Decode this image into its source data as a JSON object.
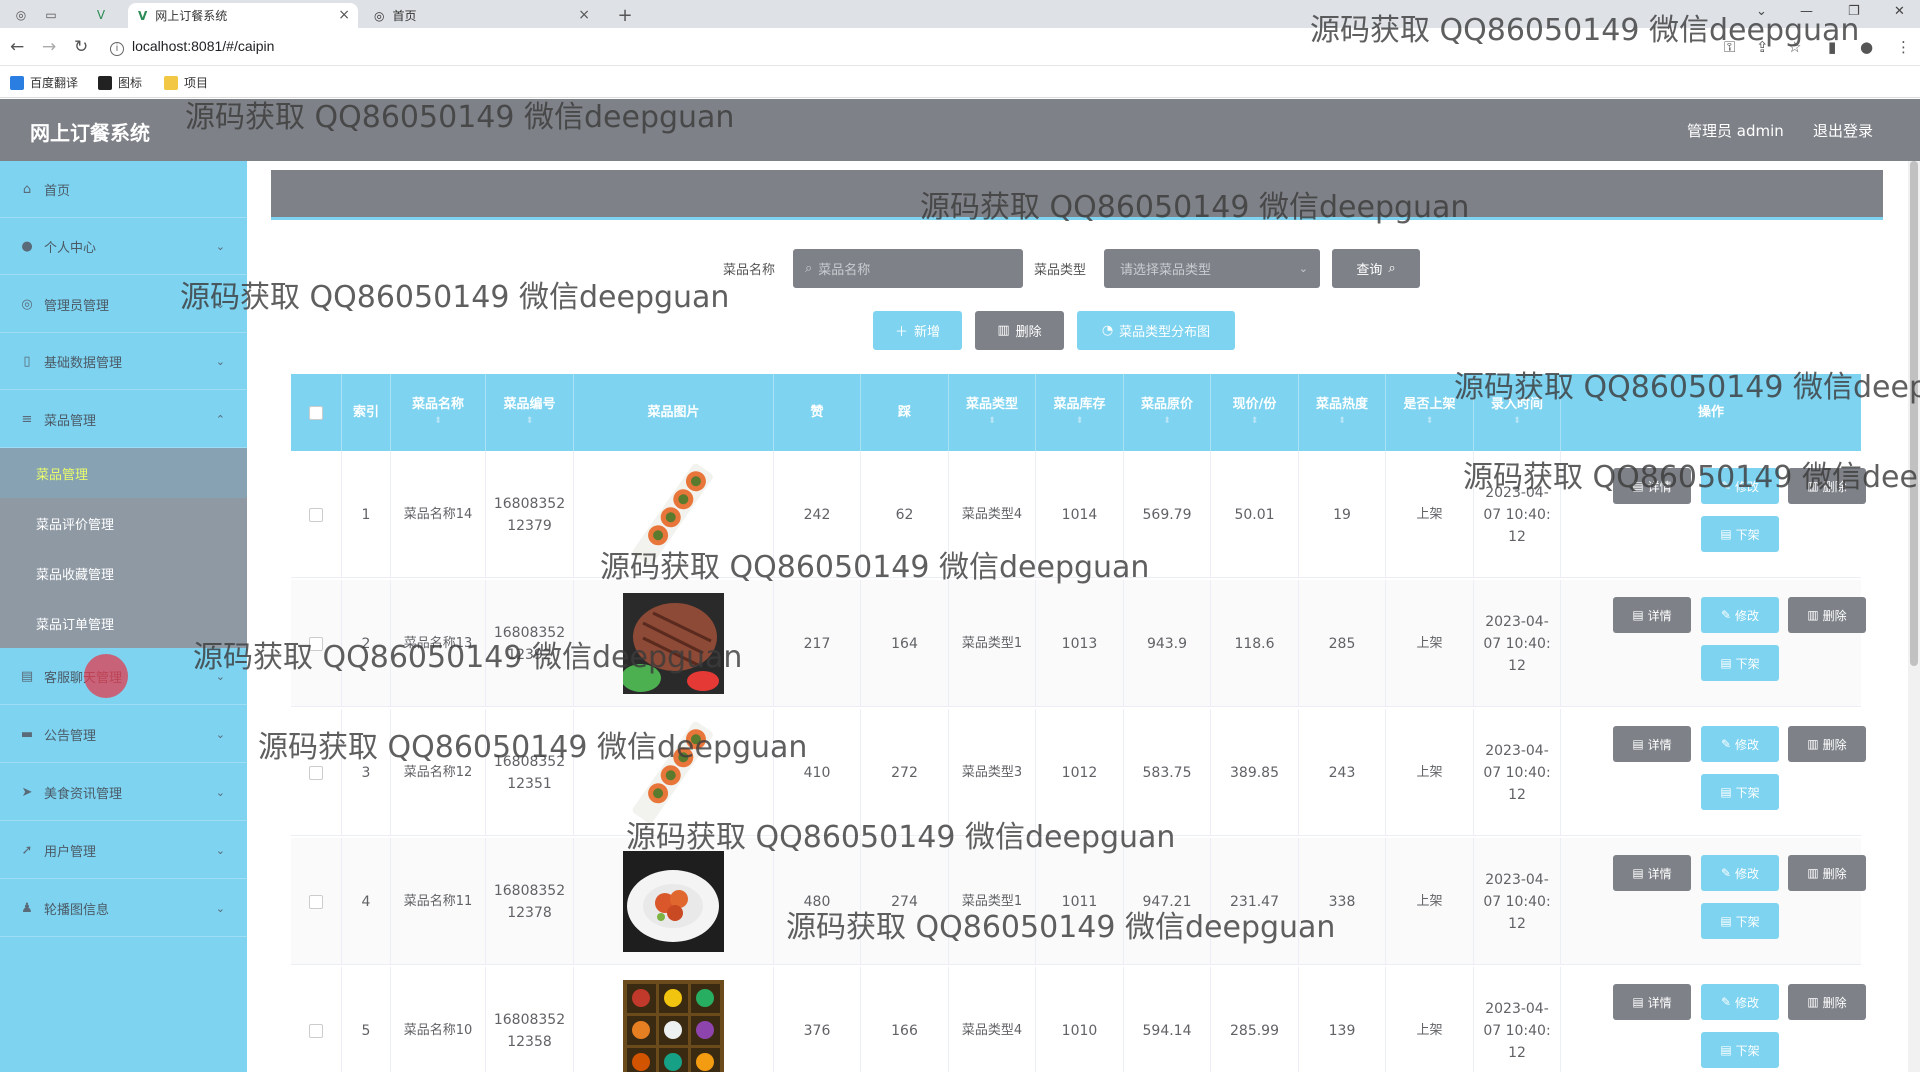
{
  "browser": {
    "tabs": [
      {
        "label": "网上订餐系统",
        "close": "×"
      },
      {
        "label": "首页",
        "close": "×"
      }
    ],
    "new_tab": "+",
    "url": "localhost:8081/#/caipin",
    "bookmarks": [
      "百度翻译",
      "图标",
      "项目"
    ]
  },
  "header": {
    "title": "网上订餐系统",
    "user": "管理员 admin",
    "logout": "退出登录"
  },
  "sidebar": {
    "items": [
      {
        "label": "首页",
        "icon": "home-icon"
      },
      {
        "label": "个人中心",
        "icon": "user-icon"
      },
      {
        "label": "管理员管理",
        "icon": "compass-icon"
      },
      {
        "label": "基础数据管理",
        "icon": "phone-icon"
      },
      {
        "label": "菜品管理",
        "icon": "menu-icon"
      },
      {
        "label": "客服聊天管理",
        "icon": "clipboard-icon"
      },
      {
        "label": "公告管理",
        "icon": "book-icon"
      },
      {
        "label": "美食资讯管理",
        "icon": "send-icon"
      },
      {
        "label": "用户管理",
        "icon": "location-icon"
      },
      {
        "label": "轮播图信息",
        "icon": "person-icon"
      }
    ],
    "sub_items": [
      "菜品管理",
      "菜品评价管理",
      "菜品收藏管理",
      "菜品订单管理"
    ]
  },
  "search": {
    "name_label": "菜品名称",
    "name_placeholder": "菜品名称",
    "type_label": "菜品类型",
    "type_placeholder": "请选择菜品类型",
    "query_button": "查询"
  },
  "actions": {
    "add": "新增",
    "delete": "删除",
    "chart": "菜品类型分布图"
  },
  "table": {
    "columns": [
      "索引",
      "菜品名称",
      "菜品编号",
      "菜品图片",
      "赞",
      "踩",
      "菜品类型",
      "菜品库存",
      "菜品原价",
      "现价/份",
      "菜品热度",
      "是否上架",
      "录入时间",
      "操作"
    ],
    "rows": [
      {
        "index": "1",
        "name": "菜品名称14",
        "code1": "16808352",
        "code2": "12379",
        "likes": "242",
        "dislikes": "62",
        "type": "菜品类型4",
        "stock": "1014",
        "orig": "569.79",
        "price": "50.01",
        "heat": "19",
        "shelf": "上架",
        "t1": "2023-04-",
        "t2": "07 10:40:",
        "t3": "12",
        "image": "sushi"
      },
      {
        "index": "2",
        "name": "菜品名称13",
        "code1": "16808352",
        "code2": "12392",
        "likes": "217",
        "dislikes": "164",
        "type": "菜品类型1",
        "stock": "1013",
        "orig": "943.9",
        "price": "118.6",
        "heat": "285",
        "shelf": "上架",
        "t1": "2023-04-",
        "t2": "07 10:40:",
        "t3": "12",
        "image": "steak"
      },
      {
        "index": "3",
        "name": "菜品名称12",
        "code1": "16808352",
        "code2": "12351",
        "likes": "410",
        "dislikes": "272",
        "type": "菜品类型3",
        "stock": "1012",
        "orig": "583.75",
        "price": "389.85",
        "heat": "243",
        "shelf": "上架",
        "t1": "2023-04-",
        "t2": "07 10:40:",
        "t3": "12",
        "image": "sushi"
      },
      {
        "index": "4",
        "name": "菜品名称11",
        "code1": "16808352",
        "code2": "12378",
        "likes": "480",
        "dislikes": "274",
        "type": "菜品类型1",
        "stock": "1011",
        "orig": "947.21",
        "price": "231.47",
        "heat": "338",
        "shelf": "上架",
        "t1": "2023-04-",
        "t2": "07 10:40:",
        "t3": "12",
        "image": "plate"
      },
      {
        "index": "5",
        "name": "菜品名称10",
        "code1": "16808352",
        "code2": "12358",
        "likes": "376",
        "dislikes": "166",
        "type": "菜品类型4",
        "stock": "1010",
        "orig": "594.14",
        "price": "285.99",
        "heat": "139",
        "shelf": "上架",
        "t1": "2023-04-",
        "t2": "07 10:40:",
        "t3": "12",
        "image": "bento"
      }
    ],
    "op_detail": "详情",
    "op_edit": "修改",
    "op_delete": "删除",
    "op_offshelf": "下架"
  },
  "watermark": "源码获取 QQ86050149 微信deepguan",
  "colors": {
    "accent": "#7dd3f0",
    "dark": "#7e8288",
    "active_sub": "#eafc6b"
  }
}
